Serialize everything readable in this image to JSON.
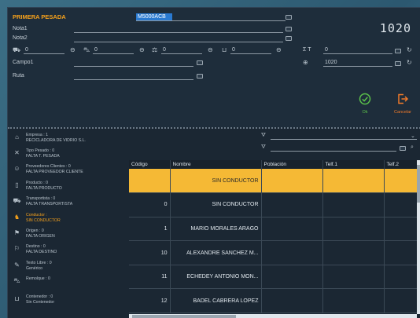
{
  "header": {
    "title": "PRIMERA PESADA",
    "code_value": "M5000ACB",
    "big_number": "1020"
  },
  "form": {
    "nota1_label": "Nota1",
    "nota2_label": "Nota2",
    "campo1_label": "Campo1",
    "ruta_label": "Ruta",
    "weights": [
      {
        "icon": "truck-icon",
        "value": "0"
      },
      {
        "icon": "trailer-icon",
        "value": "0"
      },
      {
        "icon": "scale-icon",
        "value": "0"
      },
      {
        "icon": "container-icon",
        "value": "0"
      }
    ],
    "sigma_label": "Σ T",
    "sigma_value": "0",
    "net_value": "1020"
  },
  "buttons": {
    "ok_label": "Ok",
    "cancel_label": "Cancelar"
  },
  "sidebar": {
    "items": [
      {
        "icon": "company-icon",
        "lines": [
          "Empresa : 1",
          "RECICLADORA DE VIDRIO S.L."
        ],
        "warn": false
      },
      {
        "icon": "scale-type-icon",
        "lines": [
          "Tipo Pesado : 0",
          "FALTA T. PESADA"
        ],
        "warn": false
      },
      {
        "icon": "supplier-icon",
        "lines": [
          "Proveedores Clientes : 0",
          "FALTA PROVEEDOR CLIENTE"
        ],
        "warn": false
      },
      {
        "icon": "product-icon",
        "lines": [
          "Producto : 0",
          "FALTA PRODUCTO"
        ],
        "warn": false
      },
      {
        "icon": "transport-icon",
        "lines": [
          "Transportista : 0",
          "FALTA TRANSPORTISTA"
        ],
        "warn": false
      },
      {
        "icon": "driver-icon",
        "lines": [
          "Conductor :",
          "SIN CONDUCTOR"
        ],
        "warn": true
      },
      {
        "icon": "origin-icon",
        "lines": [
          "Origen : 0",
          "FALTA ORIGEN"
        ],
        "warn": false
      },
      {
        "icon": "destination-icon",
        "lines": [
          "Destino : 0",
          "FALTA DESTINO"
        ],
        "warn": false
      },
      {
        "icon": "free-text-icon",
        "lines": [
          "Texto Libre : 0",
          "Genérico"
        ],
        "warn": false
      },
      {
        "icon": "trailer-icon",
        "lines": [
          "Remolque : 0"
        ],
        "warn": false
      },
      {
        "icon": "container-icon",
        "lines": [
          "Contenedor : 0",
          "Sin Contenedor"
        ],
        "warn": false
      }
    ]
  },
  "grid": {
    "columns": [
      "Código",
      "Nombre",
      "Población",
      "Telf.1",
      "Telf.2"
    ],
    "rows": [
      {
        "code": "",
        "name": "SIN CONDUCTOR",
        "selected": true
      },
      {
        "code": "0",
        "name": "SIN CONDUCTOR",
        "selected": false
      },
      {
        "code": "1",
        "name": "MARIO MORALES ARAGO",
        "selected": false
      },
      {
        "code": "10",
        "name": "ALEXANDRE SANCHEZ M...",
        "selected": false
      },
      {
        "code": "11",
        "name": "ECHEDEY ANTONIO MON...",
        "selected": false
      },
      {
        "code": "12",
        "name": "BADEL CABRERA LOPEZ",
        "selected": false
      }
    ]
  },
  "colors": {
    "accent_orange": "#f7a21b",
    "selected_row": "#f5b935",
    "ok_green": "#5bc24a",
    "cancel_orange": "#f07a2a",
    "highlight_blue": "#2a7ad1"
  }
}
